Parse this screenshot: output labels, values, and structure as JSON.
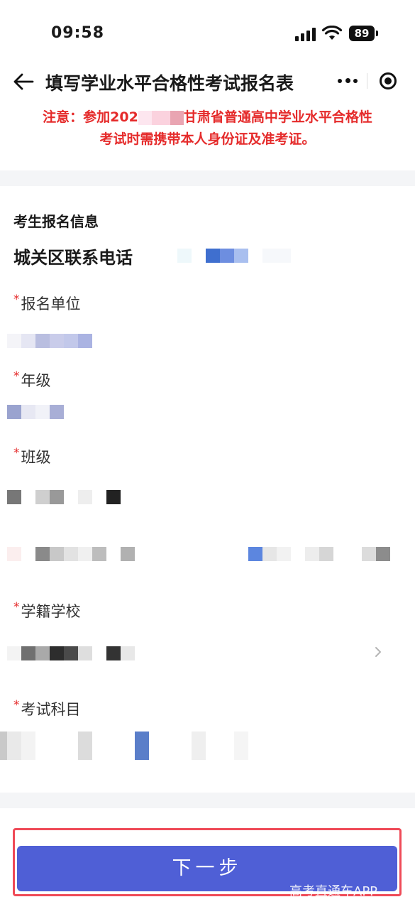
{
  "status_bar": {
    "time": "09:58",
    "battery": "89"
  },
  "nav": {
    "title": "填写学业水平合格性考试报名表"
  },
  "notice": {
    "part1": "注意：参加202",
    "part2": "甘肃省普通高中学业水平合格性",
    "line2": "考试时需携带本人身份证及准考证。"
  },
  "form": {
    "section_title": "考生报名信息",
    "phone_label": "城关区联系电话",
    "fields": [
      {
        "required_mark": "*",
        "label": "报名单位"
      },
      {
        "required_mark": "*",
        "label": "年级"
      },
      {
        "required_mark": "*",
        "label": "班级"
      },
      {
        "required_mark": "*",
        "label": "学籍学校"
      },
      {
        "required_mark": "*",
        "label": "考试科目"
      }
    ]
  },
  "footer": {
    "next_label": "下一步",
    "watermark": "高考直通车APP"
  },
  "colors": {
    "accent": "#4f5fd6",
    "notice_red": "#e52b2b",
    "highlight_border": "#ef4a57"
  }
}
